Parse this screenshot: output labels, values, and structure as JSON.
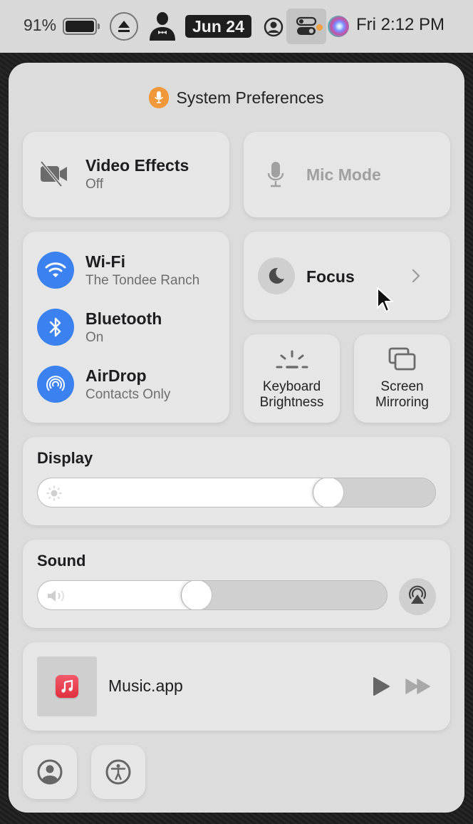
{
  "menubar": {
    "battery_percent": "91%",
    "date_badge": "Jun 24",
    "clock": "Fri 2:12 PM",
    "icons": [
      "battery-icon",
      "eject-icon",
      "butler-icon",
      "user-icon",
      "control-center-icon",
      "mic-in-use-indicator",
      "siri-icon"
    ]
  },
  "panel": {
    "header": {
      "app_name": "System Preferences",
      "icon": "microphone-icon",
      "accent": "#f0983a"
    },
    "video_effects": {
      "title": "Video Effects",
      "status": "Off",
      "icon": "video-slash-icon"
    },
    "mic_mode": {
      "title": "Mic Mode",
      "icon": "microphone-icon",
      "enabled": false
    },
    "connectivity": [
      {
        "title": "Wi-Fi",
        "status": "The Tondee Ranch",
        "icon": "wifi-icon"
      },
      {
        "title": "Bluetooth",
        "status": "On",
        "icon": "bluetooth-icon"
      },
      {
        "title": "AirDrop",
        "status": "Contacts Only",
        "icon": "airdrop-icon"
      }
    ],
    "connectivity_accent": "#3b82f0",
    "focus": {
      "title": "Focus",
      "icon": "moon-icon"
    },
    "keyboard_brightness": {
      "line1": "Keyboard",
      "line2": "Brightness",
      "icon": "keyboard-brightness-icon"
    },
    "screen_mirroring": {
      "line1": "Screen",
      "line2": "Mirroring",
      "icon": "screen-mirroring-icon"
    },
    "display": {
      "title": "Display",
      "brightness_percent": 75,
      "icon": "sun-icon"
    },
    "sound": {
      "title": "Sound",
      "volume_percent": 45,
      "icon": "speaker-icon",
      "output_icon": "airplay-audio-icon"
    },
    "now_playing": {
      "app": "Music.app",
      "controls": [
        "play",
        "fast-forward"
      ]
    },
    "bottom_buttons": [
      {
        "name": "fast-user-switching",
        "icon": "user-circle-icon"
      },
      {
        "name": "accessibility-shortcuts",
        "icon": "accessibility-icon"
      }
    ]
  }
}
